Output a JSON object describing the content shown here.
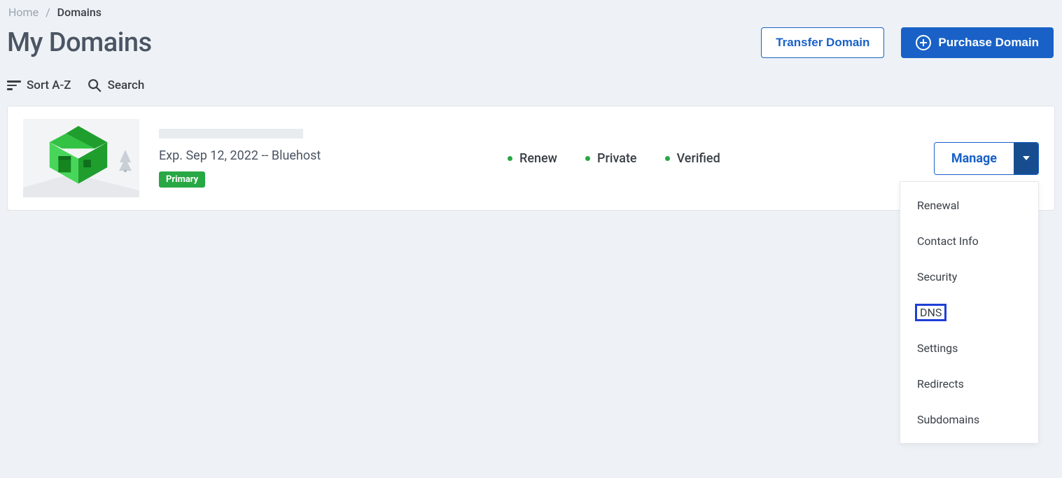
{
  "breadcrumb": {
    "home": "Home",
    "current": "Domains"
  },
  "page": {
    "title": "My Domains"
  },
  "header": {
    "transfer_label": "Transfer Domain",
    "purchase_label": "Purchase Domain"
  },
  "toolbar": {
    "sort_label": "Sort A-Z",
    "search_label": "Search"
  },
  "domain": {
    "expiration_line": "Exp. Sep 12, 2022 -- Bluehost",
    "badge": "Primary",
    "statuses": {
      "renew": "Renew",
      "private": "Private",
      "verified": "Verified"
    },
    "manage_label": "Manage"
  },
  "dropdown": {
    "items": [
      "Renewal",
      "Contact Info",
      "Security",
      "DNS",
      "Settings",
      "Redirects",
      "Subdomains"
    ],
    "highlight_index": 3
  },
  "colors": {
    "primary": "#1961c7",
    "caret_bg": "#174c8f",
    "green": "#27a844"
  }
}
